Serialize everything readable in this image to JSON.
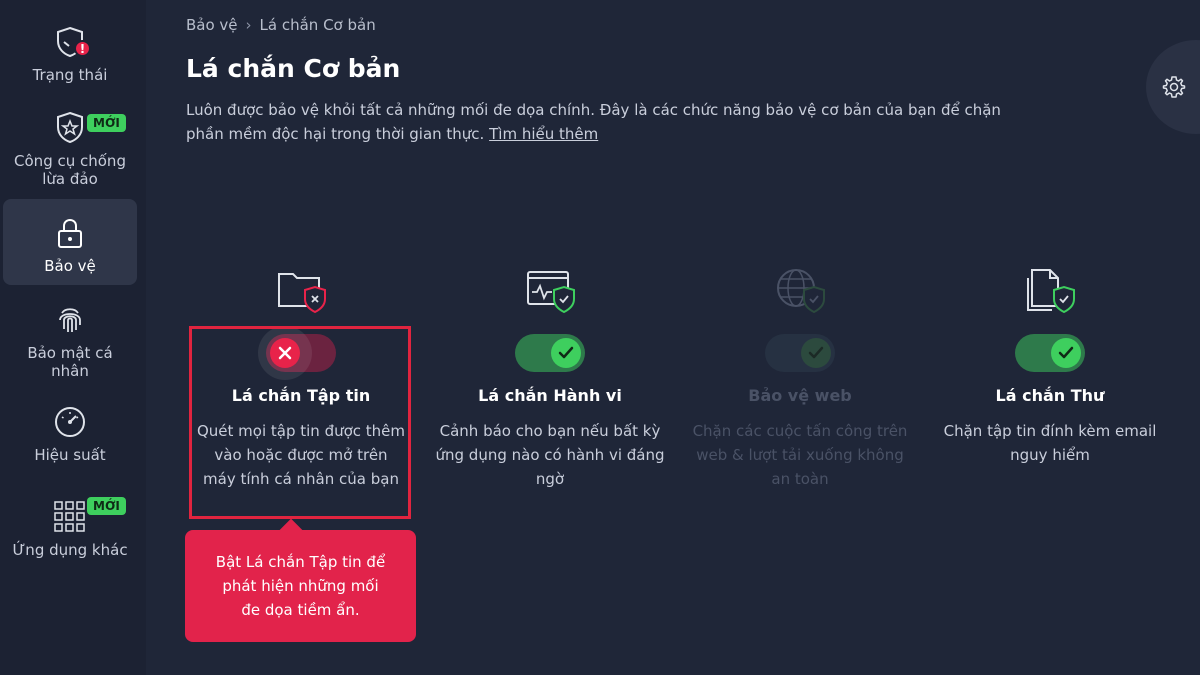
{
  "sidebar": {
    "items": [
      {
        "label": "Trạng thái",
        "icon": "shield-alert-icon",
        "alert": "!"
      },
      {
        "label": "Công cụ chống lừa đảo",
        "icon": "shield-star-icon",
        "badge": "MỚI"
      },
      {
        "label": "Bảo vệ",
        "icon": "lock-icon",
        "active": true
      },
      {
        "label": "Bảo mật cá nhân",
        "icon": "fingerprint-icon"
      },
      {
        "label": "Hiệu suất",
        "icon": "speedometer-icon"
      },
      {
        "label": "Ứng dụng khác",
        "icon": "grid-icon",
        "badge": "MỚI"
      }
    ]
  },
  "breadcrumb": {
    "parent": "Bảo vệ",
    "separator": "›",
    "current": "Lá chắn Cơ bản"
  },
  "page": {
    "title": "Lá chắn Cơ bản",
    "description": "Luôn được bảo vệ khỏi tất cả những mối đe dọa chính. Đây là các chức năng bảo vệ cơ bản của bạn để chặn phần mềm độc hại trong thời gian thực.",
    "learn_more": "Tìm hiểu thêm"
  },
  "settings": {
    "icon": "gear-icon"
  },
  "shields": [
    {
      "title": "Lá chắn Tập tin",
      "description": "Quét mọi tập tin được thêm vào hoặc được mở trên máy tính cá nhân của bạn",
      "state": "off",
      "icon": "folder-shield-icon"
    },
    {
      "title": "Lá chắn Hành vi",
      "description": "Cảnh báo cho bạn nếu bất kỳ ứng dụng nào có hành vi đáng ngờ",
      "state": "on",
      "icon": "window-pulse-icon"
    },
    {
      "title": "Bảo vệ web",
      "description": "Chặn các cuộc tấn công trên web & lượt tải xuống không an toàn",
      "state": "disabled",
      "icon": "globe-shield-icon"
    },
    {
      "title": "Lá chắn Thư",
      "description": "Chặn tập tin đính kèm email nguy hiểm",
      "state": "on",
      "icon": "document-shield-icon"
    }
  ],
  "tooltip": {
    "text": "Bật Lá chắn Tập tin để phát hiện những mối đe dọa tiềm ẩn."
  },
  "colors": {
    "accent_green": "#3ecf5e",
    "alert_red": "#e8234a",
    "background": "#1f2638"
  }
}
